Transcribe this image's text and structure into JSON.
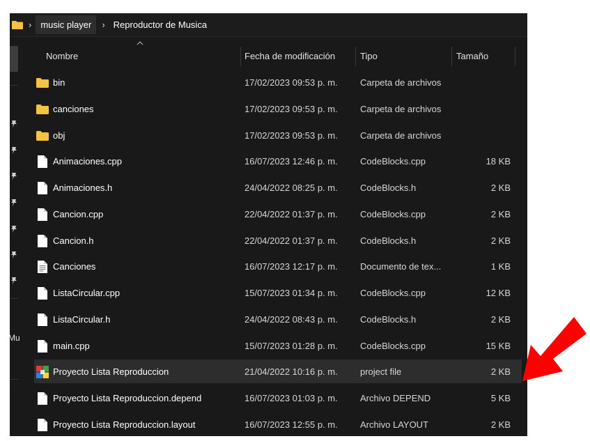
{
  "breadcrumb": {
    "folder_icon": "folder-icon",
    "items": [
      "music player",
      "Reproductor de Musica"
    ]
  },
  "columns": {
    "name": "Nombre",
    "date": "Fecha de modificación",
    "type": "Tipo",
    "size": "Tamaño"
  },
  "nav": {
    "partial_label": "Mu"
  },
  "files": [
    {
      "name": "bin",
      "date": "17/02/2023 09:53 p. m.",
      "type": "Carpeta de archivos",
      "size": "",
      "icon": "folder-icon"
    },
    {
      "name": "canciones",
      "date": "17/02/2023 09:53 p. m.",
      "type": "Carpeta de archivos",
      "size": "",
      "icon": "folder-icon"
    },
    {
      "name": "obj",
      "date": "17/02/2023 09:53 p. m.",
      "type": "Carpeta de archivos",
      "size": "",
      "icon": "folder-icon"
    },
    {
      "name": "Animaciones.cpp",
      "date": "16/07/2023 12:46 p. m.",
      "type": "CodeBlocks.cpp",
      "size": "18 KB",
      "icon": "file-icon"
    },
    {
      "name": "Animaciones.h",
      "date": "24/04/2022 08:25 p. m.",
      "type": "CodeBlocks.h",
      "size": "2 KB",
      "icon": "file-icon"
    },
    {
      "name": "Cancion.cpp",
      "date": "22/04/2022 01:37 p. m.",
      "type": "CodeBlocks.cpp",
      "size": "2 KB",
      "icon": "file-icon"
    },
    {
      "name": "Cancion.h",
      "date": "22/04/2022 01:37 p. m.",
      "type": "CodeBlocks.h",
      "size": "2 KB",
      "icon": "file-icon"
    },
    {
      "name": "Canciones",
      "date": "16/07/2023 12:17 p. m.",
      "type": "Documento de tex...",
      "size": "1 KB",
      "icon": "text-file-icon"
    },
    {
      "name": "ListaCircular.cpp",
      "date": "15/07/2023 01:34 p. m.",
      "type": "CodeBlocks.cpp",
      "size": "12 KB",
      "icon": "file-icon"
    },
    {
      "name": "ListaCircular.h",
      "date": "24/04/2022 08:43 p. m.",
      "type": "CodeBlocks.h",
      "size": "2 KB",
      "icon": "file-icon"
    },
    {
      "name": "main.cpp",
      "date": "15/07/2023 01:28 p. m.",
      "type": "CodeBlocks.cpp",
      "size": "15 KB",
      "icon": "file-icon"
    },
    {
      "name": "Proyecto Lista Reproduccion",
      "date": "21/04/2022 10:16 p. m.",
      "type": "project file",
      "size": "2 KB",
      "icon": "codeblocks-project-icon",
      "selected": true
    },
    {
      "name": "Proyecto Lista Reproduccion.depend",
      "date": "16/07/2023 01:03 p. m.",
      "type": "Archivo DEPEND",
      "size": "5 KB",
      "icon": "file-icon"
    },
    {
      "name": "Proyecto Lista Reproduccion.layout",
      "date": "16/07/2023 12:55 p. m.",
      "type": "Archivo LAYOUT",
      "size": "2 KB",
      "icon": "file-icon"
    }
  ],
  "annotation": {
    "arrow_color": "#ff0000"
  },
  "colors": {
    "background": "#191919",
    "selection": "#2d2d2d",
    "folder": "#f5c242"
  }
}
